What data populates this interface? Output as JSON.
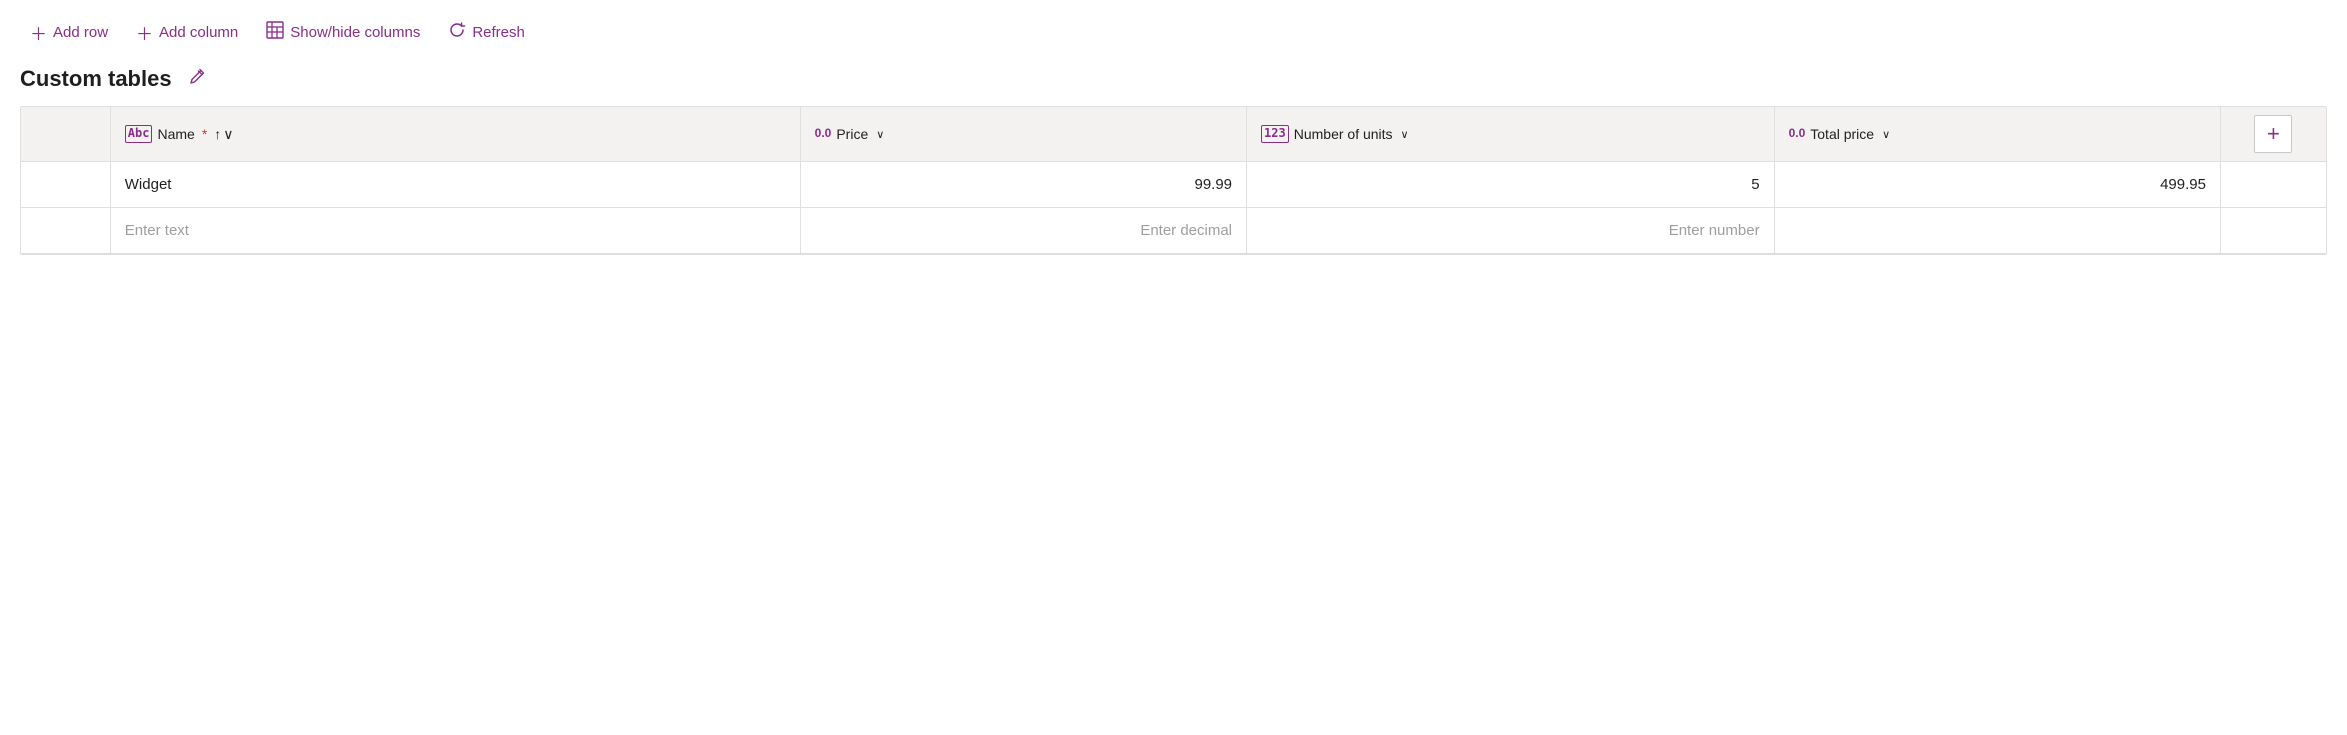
{
  "toolbar": {
    "add_row_label": "Add row",
    "add_column_label": "Add column",
    "show_hide_label": "Show/hide columns",
    "refresh_label": "Refresh"
  },
  "page": {
    "title": "Custom tables",
    "edit_tooltip": "Edit"
  },
  "table": {
    "columns": [
      {
        "id": "name",
        "icon_type": "abc",
        "icon_label": "Abc",
        "label": "Name",
        "required": true,
        "sortable": true,
        "has_dropdown": false
      },
      {
        "id": "price",
        "icon_type": "decimal",
        "icon_label": "0.0",
        "label": "Price",
        "required": false,
        "sortable": false,
        "has_dropdown": true
      },
      {
        "id": "units",
        "icon_type": "number",
        "icon_label": "123",
        "label": "Number of units",
        "required": false,
        "sortable": false,
        "has_dropdown": true
      },
      {
        "id": "total",
        "icon_type": "decimal",
        "icon_label": "0.0",
        "label": "Total price",
        "required": false,
        "sortable": false,
        "has_dropdown": true
      }
    ],
    "rows": [
      {
        "name": "Widget",
        "price": "99.99",
        "units": "5",
        "total": "499.95"
      }
    ],
    "new_row_placeholders": {
      "name": "Enter text",
      "price": "Enter decimal",
      "units": "Enter number",
      "total": ""
    },
    "add_column_label": "+"
  }
}
